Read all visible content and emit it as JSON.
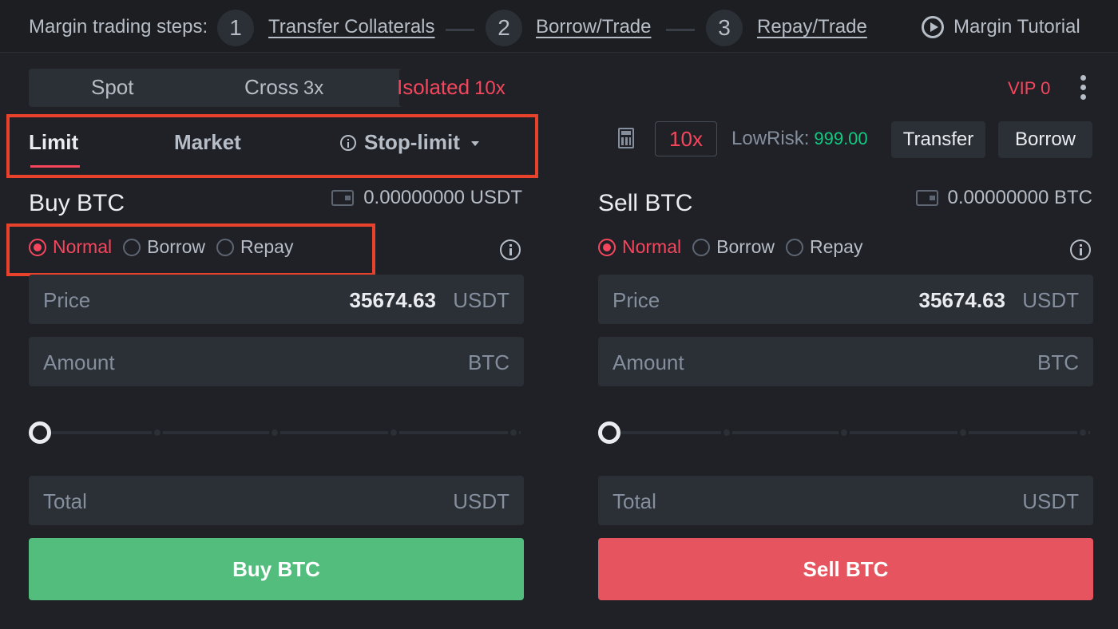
{
  "steps": {
    "label": "Margin trading steps:",
    "items": [
      {
        "num": "1",
        "label": "Transfer Collaterals"
      },
      {
        "num": "2",
        "label": "Borrow/Trade"
      },
      {
        "num": "3",
        "label": "Repay/Trade"
      }
    ],
    "tutorial": "Margin Tutorial"
  },
  "modes": [
    {
      "label": "Spot",
      "lev": ""
    },
    {
      "label": "Cross",
      "lev": "3x"
    },
    {
      "label": "Isolated",
      "lev": "10x",
      "active": true
    }
  ],
  "vip": "VIP 0",
  "order_types": {
    "limit": "Limit",
    "market": "Market",
    "stop_limit": "Stop-limit"
  },
  "controls": {
    "leverage": "10x",
    "lowrisk_label": "LowRisk:",
    "lowrisk_value": "999.00",
    "transfer": "Transfer",
    "borrow": "Borrow"
  },
  "buy": {
    "title": "Buy BTC",
    "balance": "0.00000000 USDT",
    "radios": [
      "Normal",
      "Borrow",
      "Repay"
    ],
    "price_label": "Price",
    "price_value": "35674.63",
    "price_unit": "USDT",
    "amount_label": "Amount",
    "amount_unit": "BTC",
    "slider_percent": 0,
    "total_label": "Total",
    "total_unit": "USDT",
    "button": "Buy BTC"
  },
  "sell": {
    "title": "Sell BTC",
    "balance": "0.00000000 BTC",
    "radios": [
      "Normal",
      "Borrow",
      "Repay"
    ],
    "price_label": "Price",
    "price_value": "35674.63",
    "price_unit": "USDT",
    "amount_label": "Amount",
    "amount_unit": "BTC",
    "slider_percent": 0,
    "total_label": "Total",
    "total_unit": "USDT",
    "button": "Sell BTC"
  },
  "colors": {
    "buy": "#53bd7d",
    "sell": "#e6555f",
    "accent": "#f6465d",
    "highlight": "#e8412c",
    "green_value": "#0ecb81"
  }
}
